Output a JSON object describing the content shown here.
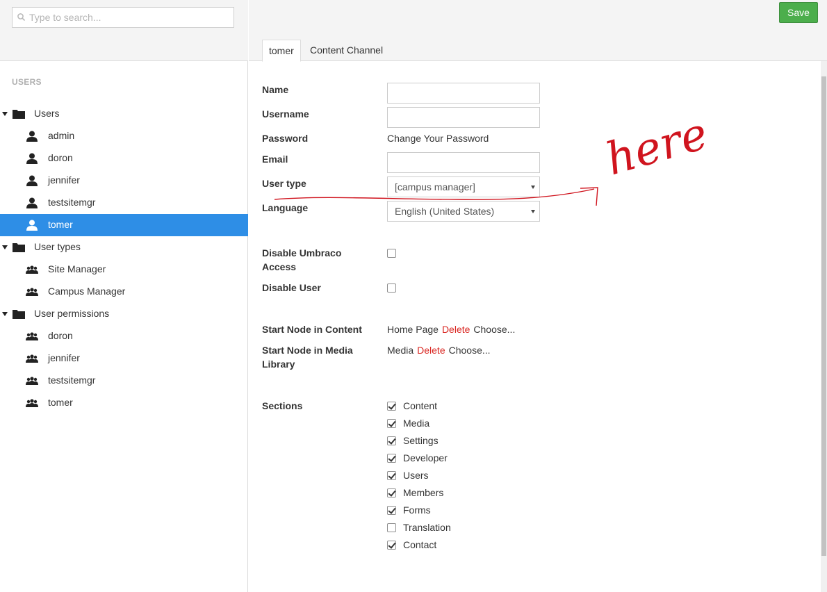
{
  "search": {
    "placeholder": "Type to search..."
  },
  "sidebar": {
    "heading": "USERS",
    "tree": [
      {
        "label": "Users",
        "level": 0,
        "type": "folder"
      },
      {
        "label": "admin",
        "level": 1,
        "type": "user"
      },
      {
        "label": "doron",
        "level": 1,
        "type": "user"
      },
      {
        "label": "jennifer",
        "level": 1,
        "type": "user"
      },
      {
        "label": "testsitemgr",
        "level": 1,
        "type": "user"
      },
      {
        "label": "tomer",
        "level": 1,
        "type": "user",
        "selected": true
      },
      {
        "label": "User types",
        "level": 0,
        "type": "folder"
      },
      {
        "label": "Site Manager",
        "level": 1,
        "type": "group"
      },
      {
        "label": "Campus Manager",
        "level": 1,
        "type": "group"
      },
      {
        "label": "User permissions",
        "level": 0,
        "type": "folder"
      },
      {
        "label": "doron",
        "level": 1,
        "type": "group"
      },
      {
        "label": "jennifer",
        "level": 1,
        "type": "group"
      },
      {
        "label": "testsitemgr",
        "level": 1,
        "type": "group"
      },
      {
        "label": "tomer",
        "level": 1,
        "type": "group"
      }
    ]
  },
  "toolbar": {
    "save_label": "Save"
  },
  "tabs": [
    {
      "label": "tomer",
      "active": true
    },
    {
      "label": "Content Channel",
      "active": false
    }
  ],
  "form": {
    "name_label": "Name",
    "name_value": "",
    "username_label": "Username",
    "username_value": "",
    "password_label": "Password",
    "password_link": "Change Your Password",
    "email_label": "Email",
    "email_value": "",
    "usertype_label": "User type",
    "usertype_value": "[campus manager]",
    "language_label": "Language",
    "language_value": "English (United States)",
    "disable_access_label": "Disable Umbraco Access",
    "disable_user_label": "Disable User",
    "start_content_label": "Start Node in Content",
    "start_content_node": "Home Page",
    "start_media_label": "Start Node in Media Library",
    "start_media_node": "Media",
    "delete_label": "Delete",
    "choose_label": "Choose...",
    "sections_label": "Sections",
    "sections": [
      {
        "label": "Content",
        "checked": true
      },
      {
        "label": "Media",
        "checked": true
      },
      {
        "label": "Settings",
        "checked": true
      },
      {
        "label": "Developer",
        "checked": true
      },
      {
        "label": "Users",
        "checked": true
      },
      {
        "label": "Members",
        "checked": true
      },
      {
        "label": "Forms",
        "checked": true
      },
      {
        "label": "Translation",
        "checked": false
      },
      {
        "label": "Contact",
        "checked": true
      }
    ]
  },
  "annotation": {
    "text": "here",
    "color": "#d0141e"
  },
  "colors": {
    "selected": "#2e8ee6",
    "save": "#4cae4c",
    "delete": "#d9241f"
  }
}
